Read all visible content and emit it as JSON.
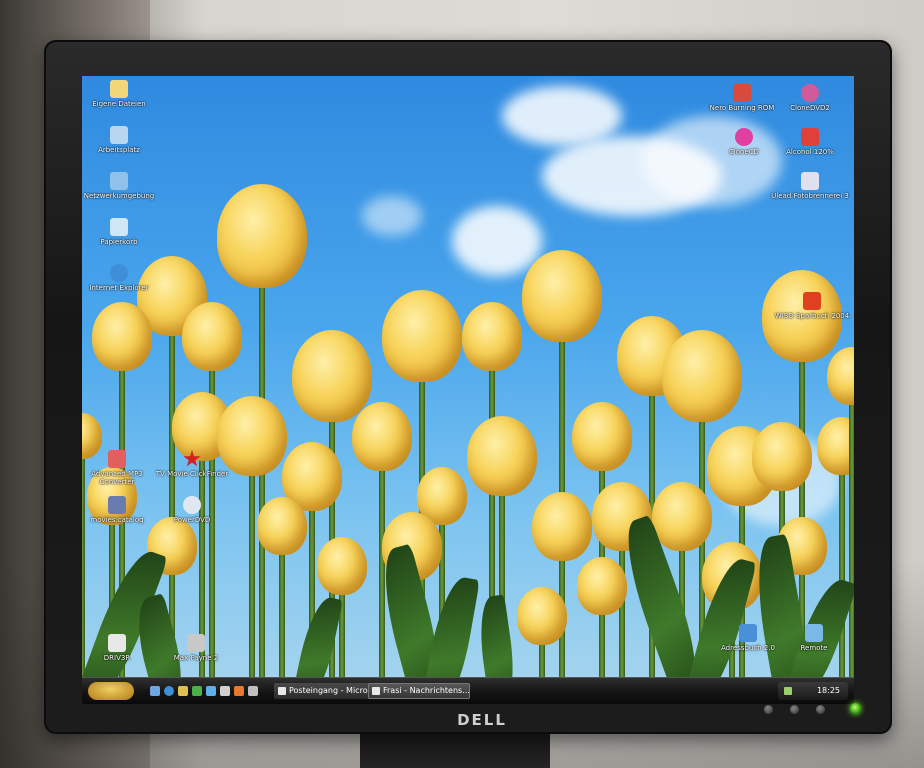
{
  "desktop": {
    "icons_left": [
      {
        "label": "Eigene Dateien",
        "icon": "folder-icon",
        "color": "#f2d77a"
      },
      {
        "label": "Arbeitsplatz",
        "icon": "computer-icon",
        "color": "#b8d6f0"
      },
      {
        "label": "Netzwerkumgebung",
        "icon": "network-icon",
        "color": "#8ec2ea"
      },
      {
        "label": "Papierkorb",
        "icon": "recycle-bin-icon",
        "color": "#cfe6f5"
      },
      {
        "label": "Internet Explorer",
        "icon": "internet-explorer-icon",
        "color": "#3f8fd8"
      }
    ],
    "icons_left_lower": [
      {
        "label": "Advanced MP3 Converter",
        "icon": "mp3-converter-icon",
        "color": "#e06060"
      },
      {
        "label": "TV Movie ClickFinder",
        "icon": "tv-movie-icon",
        "color": "#d62020"
      },
      {
        "label": "movies.catalog",
        "icon": "film-icon",
        "color": "#6a7bb0"
      },
      {
        "label": "PowerDVD",
        "icon": "dvd-icon",
        "color": "#dfe8f0"
      },
      {
        "label": "DRIV3R",
        "icon": "driver-game-icon",
        "color": "#e8e8e8"
      },
      {
        "label": "Max Payne 2",
        "icon": "max-payne-icon",
        "color": "#c8c8c8"
      }
    ],
    "icons_right": [
      {
        "label": "Nero Burning ROM",
        "icon": "nero-icon",
        "color": "#d84a3a"
      },
      {
        "label": "CloneDVD2",
        "icon": "clonedvd-icon",
        "color": "#d05a9a"
      },
      {
        "label": "CloneCD",
        "icon": "clonecd-icon",
        "color": "#e040a0"
      },
      {
        "label": "Alcohol 120%",
        "icon": "alcohol-icon",
        "color": "#e0403a"
      },
      {
        "label": "Ulead Fotobrennerei 3",
        "icon": "ulead-icon",
        "color": "#e0e0f0"
      },
      {
        "label": "WISO Sparbuch 2004",
        "icon": "wiso-icon",
        "color": "#e04020"
      },
      {
        "label": "Adressbuch 2.0",
        "icon": "address-book-icon",
        "color": "#4a90d8"
      },
      {
        "label": "Remote",
        "icon": "remote-icon",
        "color": "#7ab8e8"
      }
    ]
  },
  "taskbar": {
    "tasks": [
      {
        "label": "Posteingang - Micro...",
        "active": false
      },
      {
        "label": "Frasi - Nachrichtens...",
        "active": true
      }
    ],
    "clock": "18:25"
  },
  "monitor": {
    "brand": "DELL"
  },
  "colors": {
    "tulip": "#f2c94c",
    "sky": "#3c8fd6",
    "power_led": "#5ee02a"
  }
}
